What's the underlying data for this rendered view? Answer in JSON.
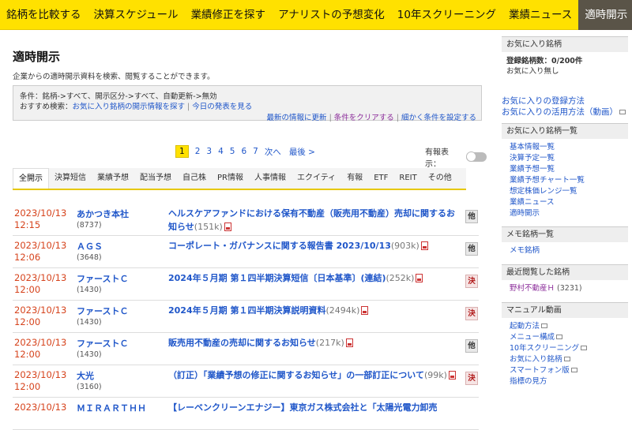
{
  "nav": [
    {
      "label": "銘柄を比較する",
      "active": false
    },
    {
      "label": "決算スケジュール",
      "active": false
    },
    {
      "label": "業績修正を探す",
      "active": false
    },
    {
      "label": "アナリストの予想変化",
      "active": false
    },
    {
      "label": "10年スクリーニング",
      "active": false
    },
    {
      "label": "業績ニュース",
      "active": false
    },
    {
      "label": "適時開示",
      "active": true
    }
  ],
  "page": {
    "title": "適時開示",
    "desc": "企業からの適時開示資料を検索、閲覧することができます。"
  },
  "conditions": {
    "line1": "条件：銘柄->すべて、開示区分->すべて、自動更新->無効",
    "recommend_label": "おすすめ検索：",
    "recommend_1": "お気に入り銘柄の開示情報を探す",
    "recommend_2": "今日の発表を見る",
    "link_update": "最新の情報に更新",
    "link_clear": "条件をクリアする",
    "link_detail": "細かく条件を設定する"
  },
  "pager": {
    "pages": [
      "1",
      "2",
      "3",
      "4",
      "5",
      "6",
      "7"
    ],
    "current": "1",
    "next": "次へ",
    "last": "最後 >"
  },
  "chart_toggle_label": "有報表示：",
  "tabs": [
    {
      "label": "全開示",
      "active": true
    },
    {
      "label": "決算短信"
    },
    {
      "label": "業績予想"
    },
    {
      "label": "配当予想"
    },
    {
      "label": "自己株"
    },
    {
      "label": "PR情報"
    },
    {
      "label": "人事情報"
    },
    {
      "label": "エクイティ"
    },
    {
      "label": "有報"
    },
    {
      "label": "ETF"
    },
    {
      "label": "REIT"
    },
    {
      "label": "その他"
    }
  ],
  "rows": [
    {
      "date": "2023/10/13",
      "time": "12:15",
      "name": "あかつき本社",
      "code": "(8737)",
      "title": "ヘルスケアファンドにおける保有不動産（販売用不動産）売却に関するお知らせ",
      "size": "(151k)",
      "badge": "他",
      "badge_type": "other"
    },
    {
      "date": "2023/10/13",
      "time": "12:06",
      "name": "ＡＧＳ",
      "code": "(3648)",
      "title": "コーポレート・ガバナンスに関する報告書 2023/10/13",
      "size": "(903k)",
      "badge": "他",
      "badge_type": "other"
    },
    {
      "date": "2023/10/13",
      "time": "12:00",
      "name": "ファーストＣ",
      "code": "(1430)",
      "title": "2024年５月期 第１四半期決算短信〔日本基準〕(連結)",
      "size": "(252k)",
      "badge": "決",
      "badge_type": "kessan"
    },
    {
      "date": "2023/10/13",
      "time": "12:00",
      "name": "ファーストＣ",
      "code": "(1430)",
      "title": "2024年５月期 第１四半期決算説明資料",
      "size": "(2494k)",
      "badge": "決",
      "badge_type": "kessan"
    },
    {
      "date": "2023/10/13",
      "time": "12:00",
      "name": "ファーストＣ",
      "code": "(1430)",
      "title": "販売用不動産の売却に関するお知らせ",
      "size": "(217k)",
      "badge": "他",
      "badge_type": "other"
    },
    {
      "date": "2023/10/13",
      "time": "12:00",
      "name": "大光",
      "code": "(3160)",
      "title": "（訂正）「業績予想の修正に関するお知らせ」の一部訂正について",
      "size": "(99k)",
      "badge": "決",
      "badge_type": "kessan"
    },
    {
      "date": "2023/10/13",
      "time": "",
      "name": "ＭＩＲＡＲＴＨＨ",
      "code": "",
      "title": "【レーベンクリーンエナジー】東京ガス株式会社と「太陽光電力卸売",
      "size": "",
      "badge": "",
      "badge_type": "other"
    }
  ],
  "sidebar": {
    "fav_title": "お気に入り銘柄",
    "fav_count": "登録銘柄数：0/200件",
    "fav_none": "お気に入り無し",
    "fav_how": "お気に入りの登録方法",
    "fav_use": "お気に入りの活用方法（動画）",
    "list_title": "お気に入り銘柄一覧",
    "list_items": [
      "基本情報一覧",
      "決算予定一覧",
      "業績予想一覧",
      "業績予想チャート一覧",
      "想定株価レンジ一覧",
      "業績ニュース",
      "適時開示"
    ],
    "memo_title": "メモ銘柄一覧",
    "memo_item": "メモ銘柄",
    "recent_title": "最近閲覧した銘柄",
    "recent_item": "野村不動産Ｈ",
    "recent_code": "(3231)",
    "manual_title": "マニュアル動画",
    "manual_items": [
      "起動方法",
      "メニュー構成",
      "10年スクリーニング",
      "お気に入り銘柄",
      "スマートフォン版",
      "指標の見方"
    ]
  }
}
